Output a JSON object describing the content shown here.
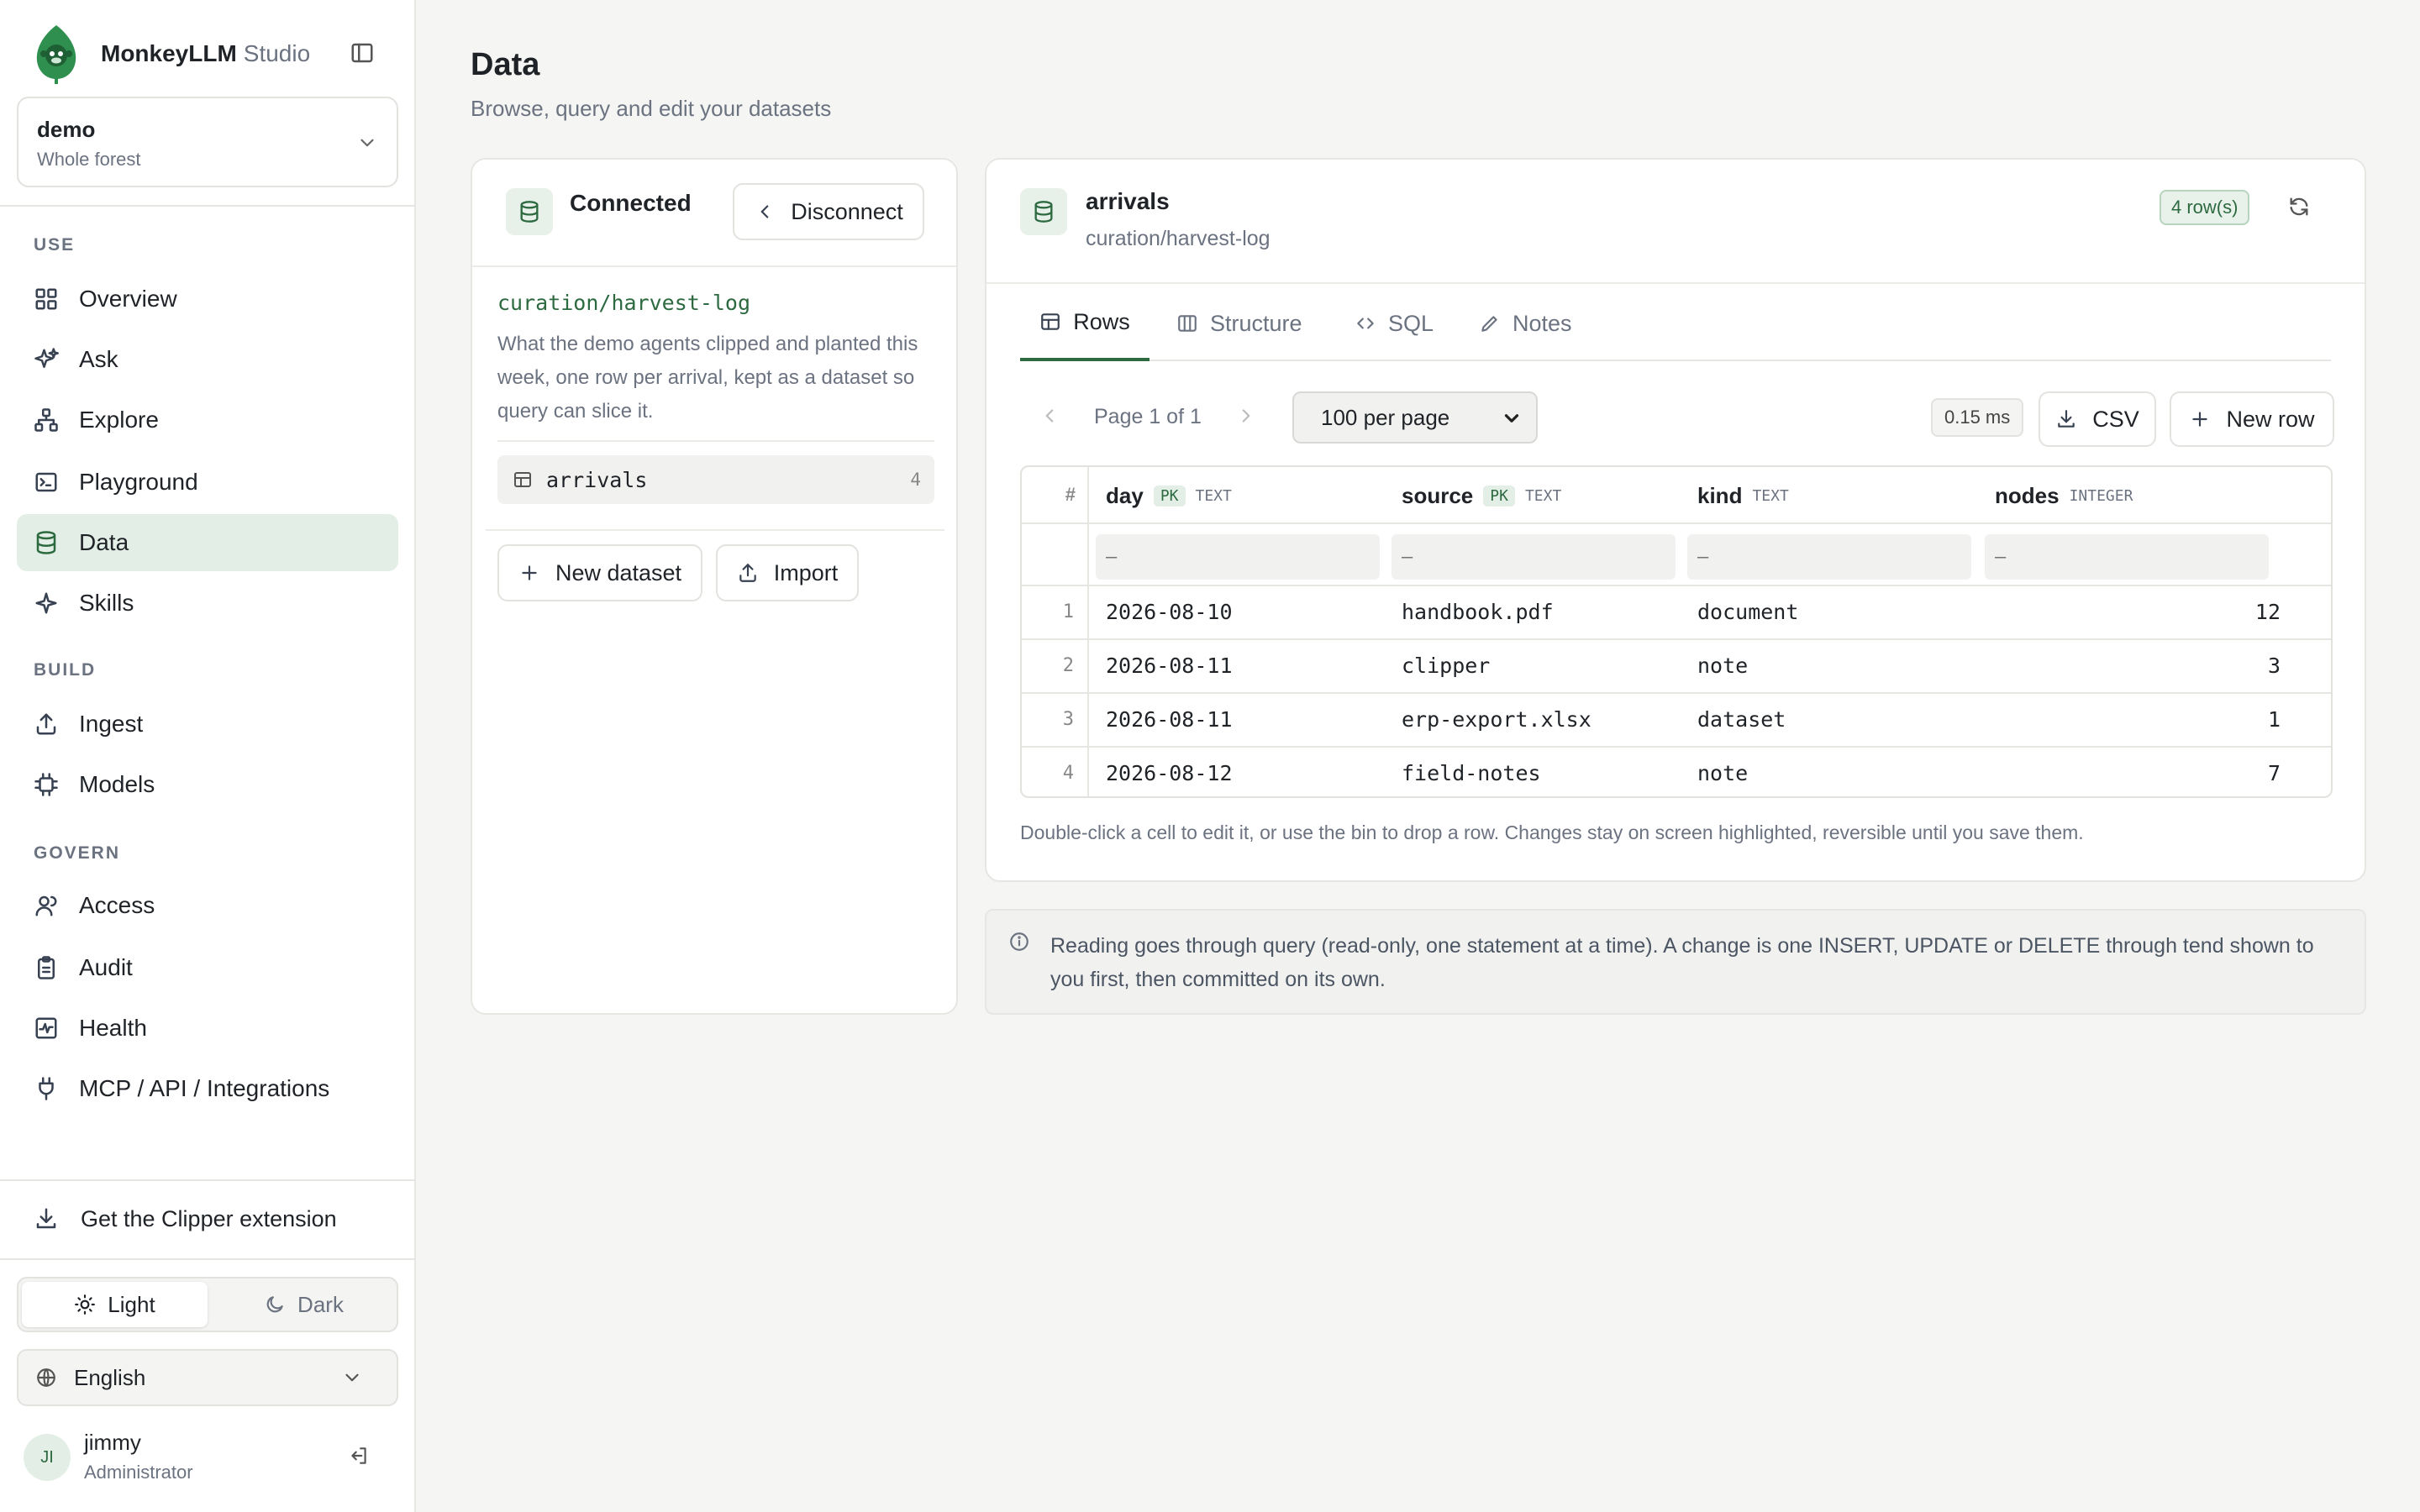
{
  "brand": {
    "name": "MonkeyLLM",
    "suffix": "Studio"
  },
  "workspace": {
    "name": "demo",
    "scope": "Whole forest"
  },
  "sidebar": {
    "sections": [
      "USE",
      "BUILD",
      "GOVERN"
    ],
    "items": [
      {
        "label": "Overview",
        "icon": "grid-icon"
      },
      {
        "label": "Ask",
        "icon": "sparkle-icon"
      },
      {
        "label": "Explore",
        "icon": "hierarchy-icon"
      },
      {
        "label": "Playground",
        "icon": "terminal-icon"
      },
      {
        "label": "Data",
        "icon": "database-icon",
        "active": true
      },
      {
        "label": "Skills",
        "icon": "star-icon"
      },
      {
        "label": "Ingest",
        "icon": "upload-icon"
      },
      {
        "label": "Models",
        "icon": "chip-icon"
      },
      {
        "label": "Access",
        "icon": "users-icon"
      },
      {
        "label": "Audit",
        "icon": "clipboard-icon"
      },
      {
        "label": "Health",
        "icon": "pulse-icon"
      },
      {
        "label": "MCP / API / Integrations",
        "icon": "plug-icon"
      }
    ],
    "extension": "Get the Clipper extension",
    "theme": {
      "light": "Light",
      "dark": "Dark",
      "selected": "Light"
    },
    "language": "English",
    "user": {
      "initials": "JI",
      "name": "jimmy",
      "role": "Administrator"
    }
  },
  "page": {
    "title": "Data",
    "subtitle": "Browse, query and edit your datasets"
  },
  "connection": {
    "status": "Connected",
    "disconnect": "Disconnect",
    "path": "curation/harvest-log",
    "description": "What the demo agents clipped and planted this week, one row per arrival, kept as a dataset so query can slice it.",
    "datasets": [
      {
        "name": "arrivals",
        "count": "4"
      }
    ],
    "new_dataset": "New dataset",
    "import": "Import"
  },
  "table_view": {
    "name": "arrivals",
    "path": "curation/harvest-log",
    "row_badge": "4 row(s)",
    "tabs": [
      "Rows",
      "Structure",
      "SQL",
      "Notes"
    ],
    "active_tab": "Rows",
    "pager": {
      "text": "Page 1 of 1",
      "per_page": "100 per page",
      "per_page_options": [
        "100 per page"
      ]
    },
    "timing": "0.15 ms",
    "csv": "CSV",
    "new_row": "New row",
    "hash": "#",
    "filter_placeholder": "—",
    "columns": [
      {
        "name": "day",
        "pk": "PK",
        "type": "TEXT"
      },
      {
        "name": "source",
        "pk": "PK",
        "type": "TEXT"
      },
      {
        "name": "kind",
        "pk": "",
        "type": "TEXT"
      },
      {
        "name": "nodes",
        "pk": "",
        "type": "INTEGER"
      }
    ],
    "rows": [
      {
        "idx": "1",
        "day": "2026-08-10",
        "source": "handbook.pdf",
        "kind": "document",
        "nodes": "12"
      },
      {
        "idx": "2",
        "day": "2026-08-11",
        "source": "clipper",
        "kind": "note",
        "nodes": "3"
      },
      {
        "idx": "3",
        "day": "2026-08-11",
        "source": "erp-export.xlsx",
        "kind": "dataset",
        "nodes": "1"
      },
      {
        "idx": "4",
        "day": "2026-08-12",
        "source": "field-notes",
        "kind": "note",
        "nodes": "7"
      }
    ],
    "footnote": "Double-click a cell to edit it, or use the bin to drop a row. Changes stay on screen highlighted, reversible until you save them."
  },
  "info_note": "Reading goes through query (read-only, one statement at a time). A change is one INSERT, UPDATE or DELETE through tend shown to you first, then committed on its own.",
  "colors": {
    "accent": "#2d6a40",
    "accent_soft": "#e3efe6",
    "background": "#f5f5f4"
  }
}
